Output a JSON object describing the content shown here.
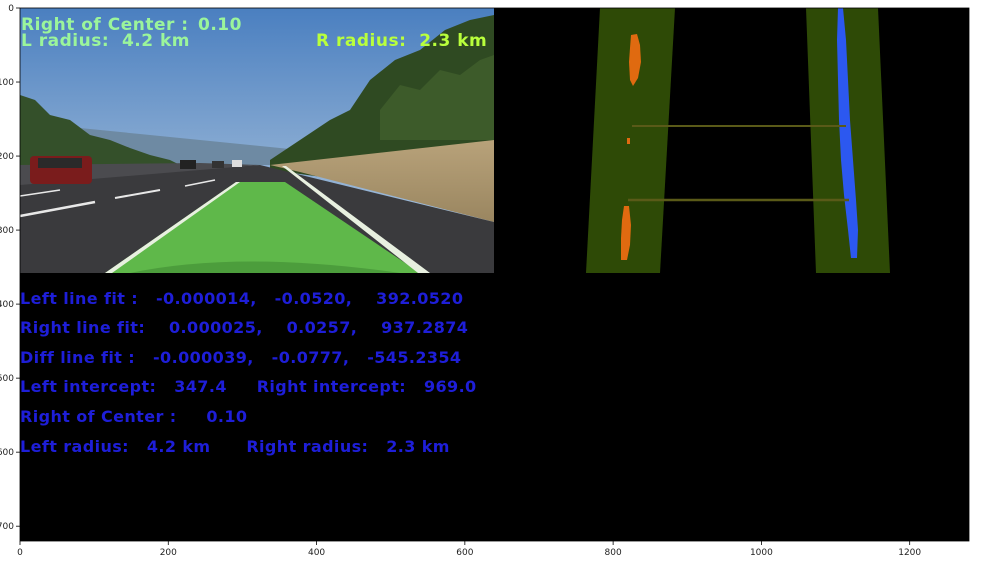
{
  "overlay": {
    "center_label": "Right of Center :",
    "center_value": "0.10",
    "l_radius": "L radius:  4.2 km",
    "r_radius": "R radius:  2.3 km",
    "text_color": "#9bf59b",
    "r_radius_color": "#b9ff3c"
  },
  "info_lines": [
    "Left line fit :   -0.000014,   -0.0520,    392.0520",
    "Right line fit:    0.000025,    0.0257,    937.2874",
    "Diff line fit :   -0.000039,   -0.0777,   -545.2354",
    "Left intercept:   347.4     Right intercept:   969.0",
    "Right of Center :     0.10",
    "Left radius:   4.2 km      Right radius:   2.3 km"
  ],
  "axes": {
    "xticks": [
      "0",
      "200",
      "400",
      "600",
      "800",
      "1000",
      "1200"
    ],
    "yticks": [
      "0",
      "100",
      "200",
      "300",
      "400",
      "500",
      "600",
      "700"
    ],
    "xrange": [
      0,
      1280
    ],
    "yrange": [
      0,
      720
    ]
  },
  "colors": {
    "lane_fill": "#5fb84a",
    "lane_band": "#2e4a06",
    "left_pixels": "#e06a10",
    "right_pixels": "#2c58f0",
    "info_text": "#1e1ed8"
  }
}
